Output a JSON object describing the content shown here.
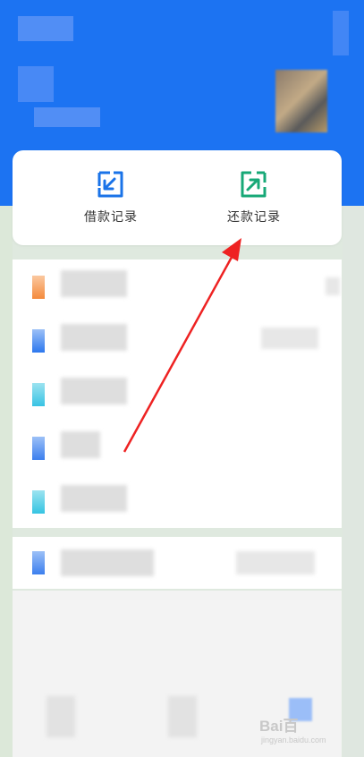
{
  "actions": {
    "borrow_records_label": "借款记录",
    "repay_records_label": "还款记录"
  },
  "colors": {
    "header_blue": "#1c73f2",
    "borrow_icon": "#1a73e8",
    "repay_icon": "#17a877",
    "arrow": "#ee2222"
  },
  "icons": {
    "borrow": "borrow-records-icon",
    "repay": "repay-records-icon"
  },
  "watermark": {
    "brand": "Bai",
    "brand_suffix": "百",
    "site": "jingyan.baidu.com"
  }
}
